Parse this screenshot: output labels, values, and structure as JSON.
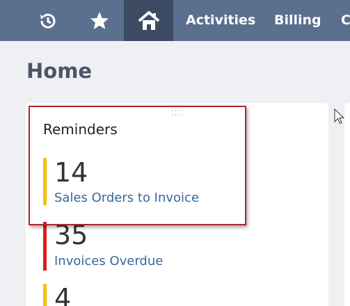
{
  "nav": {
    "recent_icon": "recent-clock-icon",
    "favorites_icon": "star-icon",
    "home_icon": "home-icon",
    "tabs": [
      {
        "label": "Activities"
      },
      {
        "label": "Billing"
      },
      {
        "label": "C"
      }
    ],
    "colors": {
      "bar": "#5b6f8e",
      "active": "#3d4b62"
    }
  },
  "page": {
    "title": "Home"
  },
  "reminders": {
    "title": "Reminders",
    "items": [
      {
        "count": "14",
        "label": "Sales Orders to Invoice",
        "color": "#f5c400"
      },
      {
        "count": "35",
        "label": "Invoices Overdue",
        "color": "#e31b1b"
      },
      {
        "count": "4",
        "label": "",
        "color": "#f5c400"
      }
    ]
  }
}
